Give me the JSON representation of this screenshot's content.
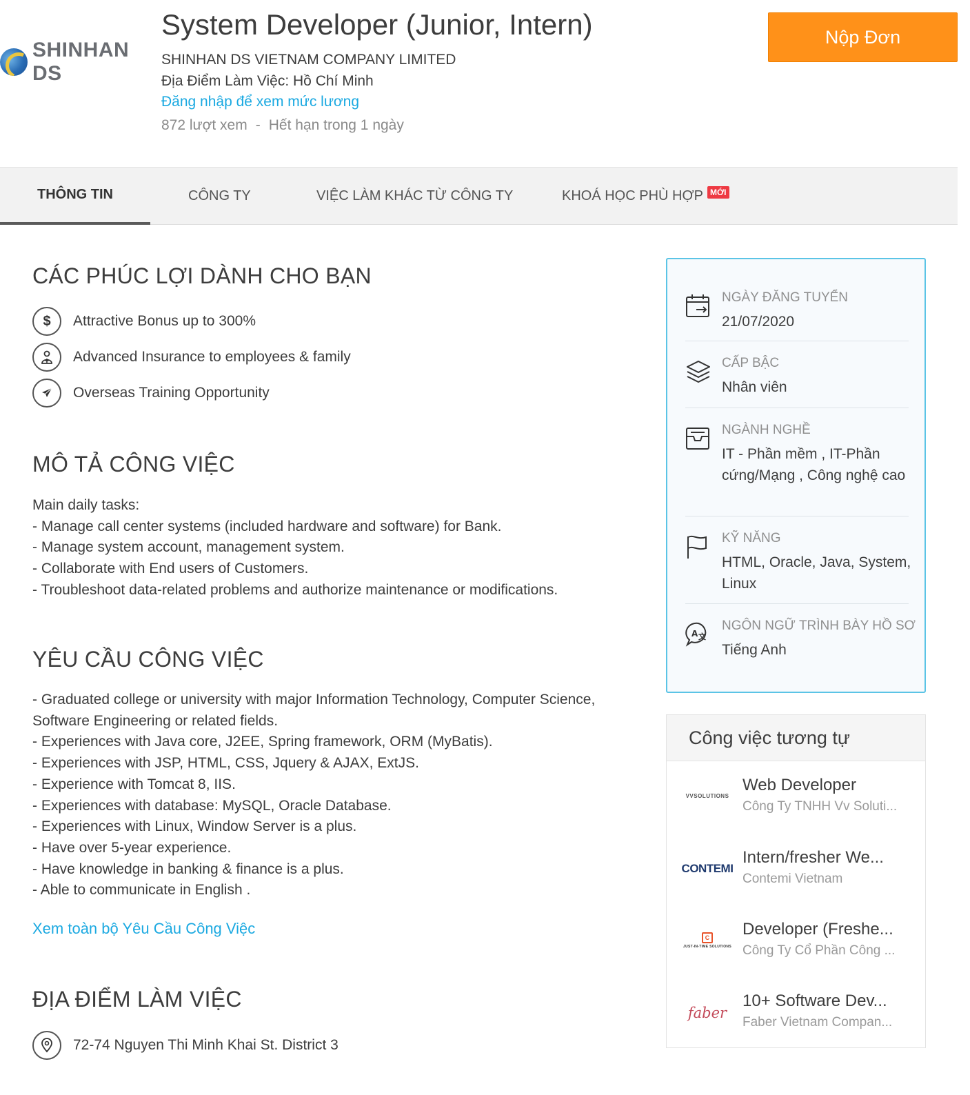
{
  "company": {
    "logo_text": "SHINHAN DS",
    "name": "SHINHAN DS VIETNAM COMPANY LIMITED"
  },
  "job": {
    "title": "System Developer (Junior, Intern)",
    "location": "Địa Điểm Làm Việc: Hồ Chí Minh",
    "salary_link": "Đăng nhập để xem mức lương",
    "views": "872 lượt xem",
    "separator": "-",
    "expiry": "Hết hạn trong 1 ngày"
  },
  "apply_button": "Nộp Đơn",
  "tabs": [
    {
      "label": "THÔNG TIN",
      "active": true
    },
    {
      "label": "CÔNG TY",
      "active": false
    },
    {
      "label": "VIỆC LÀM KHÁC TỪ CÔNG TY",
      "active": false
    },
    {
      "label": "KHOÁ HỌC PHÙ HỢP",
      "active": false,
      "badge": "MỚI"
    }
  ],
  "benefits": {
    "title": "CÁC PHÚC LỢI DÀNH CHO BẠN",
    "items": [
      {
        "icon": "dollar-icon",
        "text": "Attractive Bonus up to 300%"
      },
      {
        "icon": "doctor-icon",
        "text": "Advanced Insurance to employees & family"
      },
      {
        "icon": "airplane-icon",
        "text": "Overseas Training Opportunity"
      }
    ]
  },
  "description": {
    "title": "MÔ TẢ CÔNG VIỆC",
    "lines": [
      "Main daily tasks:",
      "- Manage call center systems (included hardware and software) for Bank.",
      "- Manage system account, management system.",
      "- Collaborate with End users of Customers.",
      "- Troubleshoot data-related problems and authorize maintenance or modifications."
    ]
  },
  "requirements": {
    "title": "YÊU CẦU CÔNG VIỆC",
    "lines": [
      "- Graduated college or university with major Information Technology, Computer Science,",
      "Software Engineering or related fields.",
      "- Experiences with Java core, J2EE, Spring framework, ORM (MyBatis).",
      "- Experiences with JSP, HTML, CSS, Jquery & AJAX, ExtJS.",
      "- Experience with Tomcat 8, IIS.",
      "- Experiences with database: MySQL, Oracle Database.",
      "- Experiences with Linux, Window Server is a plus.",
      "- Have over 5-year experience.",
      "- Have knowledge in banking & finance is a plus.",
      "- Able to communicate in English ."
    ],
    "more_link": "Xem toàn bộ Yêu Cầu Công Việc"
  },
  "workplace": {
    "title": "ĐỊA ĐIỂM LÀM VIỆC",
    "address": "72-74 Nguyen Thi Minh Khai St. District 3",
    "icon": "map-pin-icon"
  },
  "summary": {
    "posted": {
      "label": "NGÀY ĐĂNG TUYỂN",
      "value": "21/07/2020",
      "icon": "calendar-icon"
    },
    "level": {
      "label": "CẤP BẬC",
      "value": "Nhân viên",
      "icon": "layers-icon"
    },
    "industry": {
      "label": "NGÀNH NGHỀ",
      "value": "IT - Phần mềm ,  IT-Phần cứng/Mạng ,  Công nghệ cao",
      "icon": "inbox-icon"
    },
    "skills": {
      "label": "KỸ NĂNG",
      "value": "HTML, Oracle, Java, System, Linux",
      "icon": "flag-icon"
    },
    "language": {
      "label": "NGÔN NGỮ TRÌNH BÀY HỒ SƠ",
      "value": "Tiếng Anh",
      "icon": "translate-icon"
    }
  },
  "similar_jobs": {
    "title": "Công việc tương tự",
    "items": [
      {
        "title": "Web Developer",
        "company": "Công Ty TNHH Vv Soluti...",
        "logo": "VVSOLUTIONS"
      },
      {
        "title": "Intern/fresher We...",
        "company": "Contemi Vietnam",
        "logo": "CONTEMI"
      },
      {
        "title": "Developer (Freshe...",
        "company": "Công Ty Cổ Phần Công ...",
        "logo": "JUST-IN-TIME SOLUTIONS"
      },
      {
        "title": "10+ Software Dev...",
        "company": "Faber Vietnam Compan...",
        "logo": "faber"
      }
    ]
  },
  "colors": {
    "accent_blue": "#1ba9e1",
    "apply_orange": "#ff9119",
    "info_border": "#5bc4e6",
    "new_badge": "#ee3a43"
  }
}
